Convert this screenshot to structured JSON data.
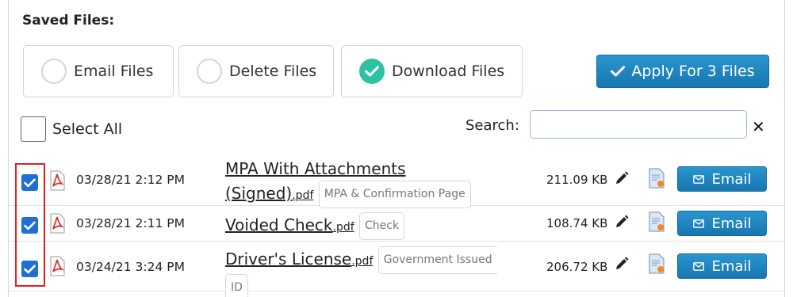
{
  "title": "Saved Files:",
  "options": [
    {
      "label": "Email Files",
      "selected": false
    },
    {
      "label": "Delete Files",
      "selected": false
    },
    {
      "label": "Download Files",
      "selected": true
    }
  ],
  "apply_label": "Apply For 3 Files",
  "select_all_label": "Select All",
  "search": {
    "label": "Search:",
    "value": "",
    "placeholder": ""
  },
  "files": [
    {
      "checked": true,
      "date": "03/28/21 2:12 PM",
      "name_line1": "MPA With Attachments",
      "name_line2": "(Signed)",
      "ext": ".pdf",
      "tag": "MPA & Confirmation Page",
      "size": "211.09 KB",
      "email_label": "Email"
    },
    {
      "checked": true,
      "date": "03/28/21 2:11 PM",
      "name": "Voided Check",
      "ext": ".pdf",
      "tag": "Check",
      "size": "108.74 KB",
      "email_label": "Email"
    },
    {
      "checked": true,
      "date": "03/24/21 3:24 PM",
      "name": "Driver's License",
      "ext": ".pdf",
      "tag_line1": "Government Issued",
      "tag_line2": "ID",
      "size": "206.72 KB",
      "email_label": "Email"
    }
  ],
  "colors": {
    "accent": "#1f86c2",
    "selected_radio": "#2cc3a2",
    "checkbox": "#1f6fd6",
    "highlight": "#e02020",
    "pdf_icon": "#d9372b"
  }
}
